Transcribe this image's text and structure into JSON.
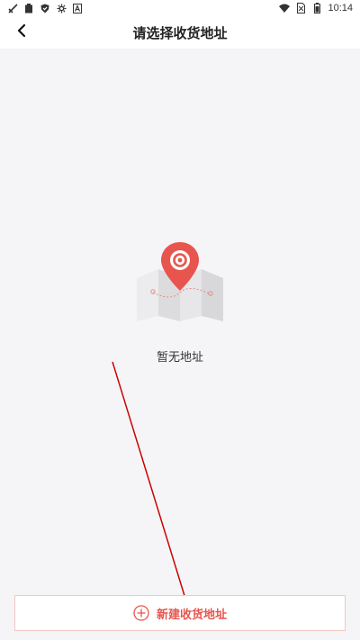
{
  "status_bar": {
    "time": "10:14",
    "left_icons": [
      "signal-off-icon",
      "clipboard-icon",
      "shield-icon",
      "settings-icon",
      "font-icon"
    ],
    "right_icons": [
      "wifi-icon",
      "no-sim-icon",
      "battery-icon"
    ]
  },
  "header": {
    "title": "请选择收货地址",
    "back_icon": "chevron-left-icon"
  },
  "empty_state": {
    "icon": "map-pin-illustration",
    "text": "暂无地址"
  },
  "add_button": {
    "label": "新建收货地址",
    "icon": "plus-circle-icon"
  },
  "colors": {
    "accent": "#e8554e",
    "background": "#f5f5f7",
    "header_bg": "#ffffff",
    "annotation": "#cc0000"
  }
}
